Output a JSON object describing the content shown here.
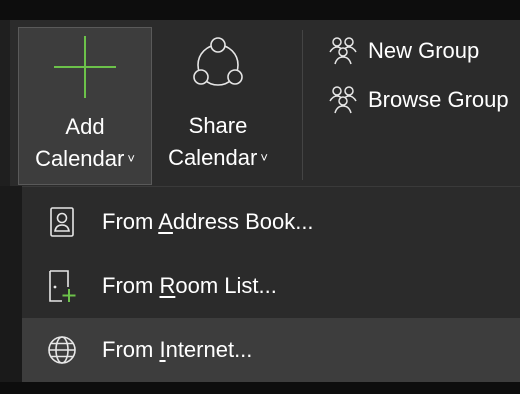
{
  "ribbon": {
    "add_calendar": {
      "line1": "Add",
      "line2": "Calendar",
      "chevron": "˅",
      "icon": "plus-icon"
    },
    "share_calendar": {
      "line1": "Share",
      "line2": "Calendar",
      "chevron": "˅",
      "icon": "share-network-icon"
    },
    "new_group": {
      "label": "New Group",
      "icon": "group-people-icon"
    },
    "browse_groups": {
      "label": "Browse Group",
      "icon": "group-people-icon"
    }
  },
  "menu": {
    "items": [
      {
        "prefix": "From ",
        "accel": "A",
        "suffix": "ddress Book...",
        "icon": "address-book-icon"
      },
      {
        "prefix": "From ",
        "accel": "R",
        "suffix": "oom List...",
        "icon": "room-list-add-icon"
      },
      {
        "prefix": "From ",
        "accel": "I",
        "suffix": "nternet...",
        "icon": "globe-icon"
      }
    ]
  },
  "colors": {
    "accent_green": "#6cc24a",
    "ribbon_bg": "#2b2b2b",
    "hover_bg": "#3d3d3d",
    "text": "#ffffff"
  }
}
